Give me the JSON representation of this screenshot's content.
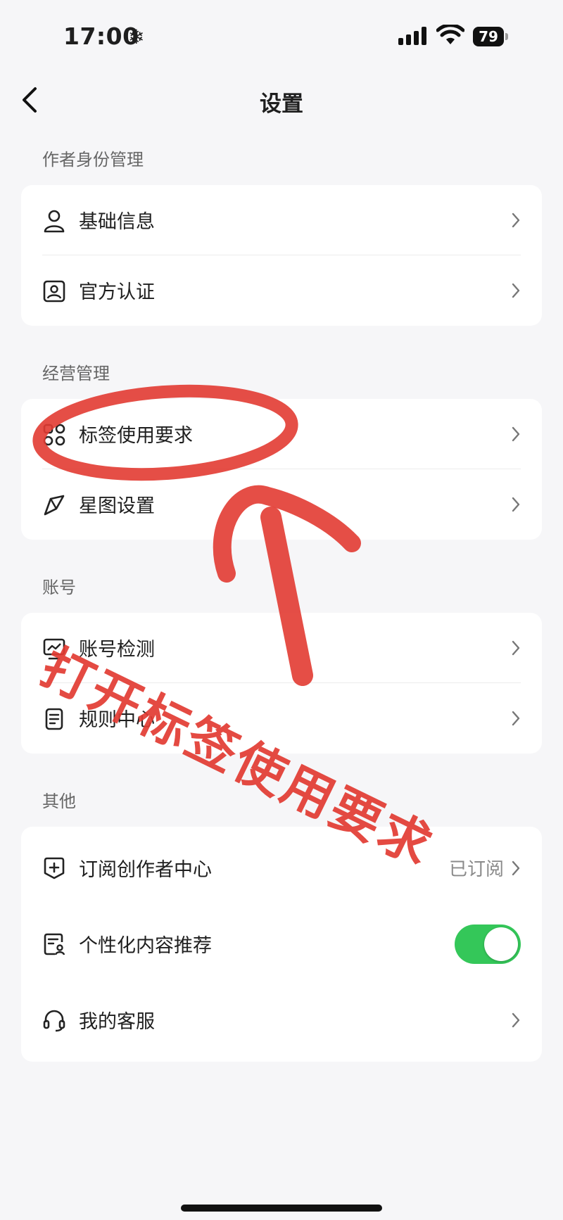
{
  "status_bar": {
    "time": "17:00",
    "battery": "79",
    "icons": [
      "snowflake-icon",
      "cellular-signal-icon",
      "wifi-icon",
      "battery-icon"
    ]
  },
  "nav": {
    "title": "设置",
    "back_icon": "chevron-left-icon"
  },
  "sections": [
    {
      "label": "作者身份管理",
      "items": [
        {
          "label": "基础信息",
          "icon": "person-icon"
        },
        {
          "label": "官方认证",
          "icon": "id-card-icon"
        }
      ]
    },
    {
      "label": "经营管理",
      "items": [
        {
          "label": "标签使用要求",
          "icon": "grid-icon"
        },
        {
          "label": "星图设置",
          "icon": "star-map-icon"
        }
      ]
    },
    {
      "label": "账号",
      "items": [
        {
          "label": "账号检测",
          "icon": "chart-monitor-icon"
        },
        {
          "label": "规则中心",
          "icon": "document-icon"
        }
      ]
    },
    {
      "label": "其他",
      "items": [
        {
          "label": "订阅创作者中心",
          "icon": "plus-shield-icon",
          "value": "已订阅"
        },
        {
          "label": "个性化内容推荐",
          "icon": "profile-doc-icon",
          "toggle": true
        },
        {
          "label": "我的客服",
          "icon": "headset-icon"
        }
      ]
    }
  ],
  "annotation": {
    "text": "打开标签使用要求",
    "color": "#e23b32"
  },
  "colors": {
    "toggle_on": "#34c759",
    "annotation": "#e23b32"
  }
}
